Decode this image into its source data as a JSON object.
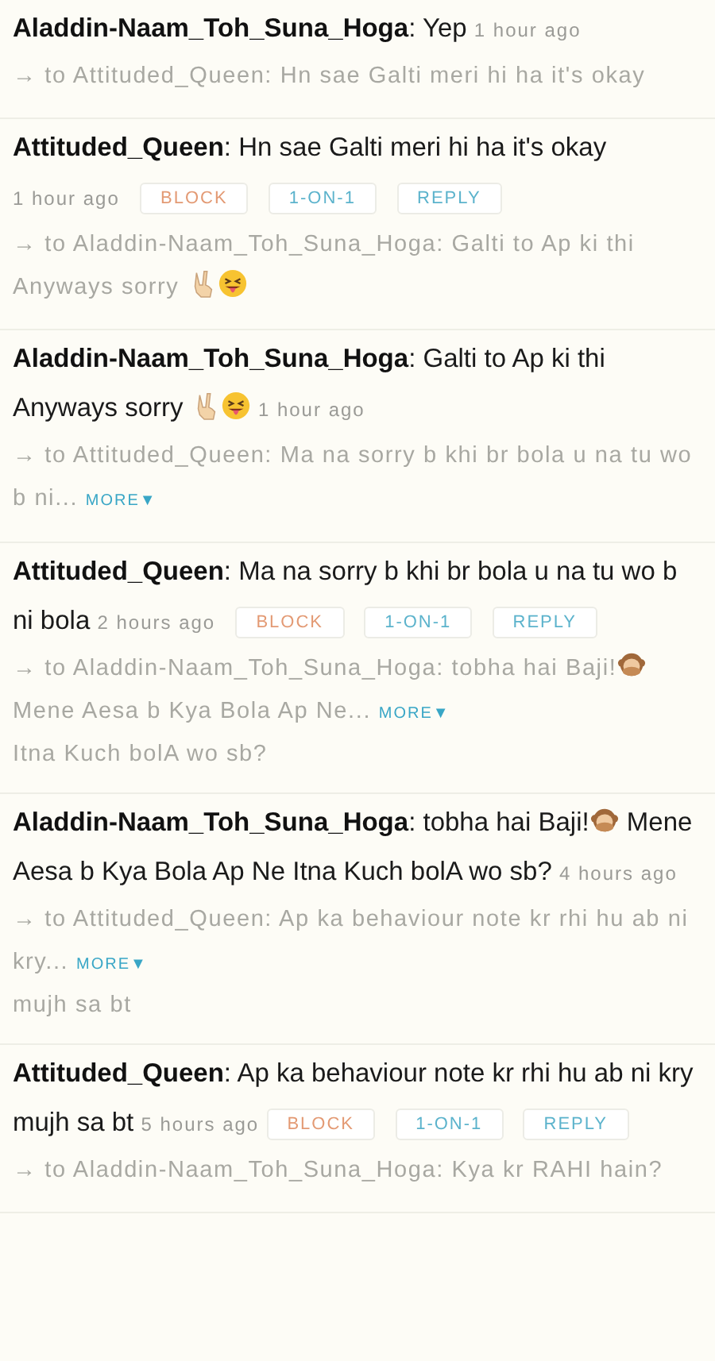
{
  "posts": [
    {
      "author": "Aladdin-Naam_Toh_Suna_Hoga",
      "separator": ":",
      "body": [
        {
          "kind": "text",
          "text": "Yep"
        }
      ],
      "time": "1 hour ago",
      "reply": {
        "body": [
          {
            "kind": "text",
            "text": "→ to Attituded_Queen: Hn sae Galti meri hi ha it's okay"
          }
        ]
      }
    },
    {
      "author": "Attituded_Queen",
      "separator": ":",
      "body": [
        {
          "kind": "text",
          "text": "Hn sae Galti meri hi ha it's okay"
        }
      ],
      "time": "1 hour ago",
      "actions": [
        {
          "label": "BLOCK",
          "color": "#e39a74"
        },
        {
          "label": "1-ON-1",
          "color": "#5cb3cc"
        },
        {
          "label": "REPLY",
          "color": "#5cb3cc"
        }
      ],
      "reply": {
        "body": [
          {
            "kind": "text",
            "text": "→ to Aladdin-Naam_Toh_Suna_Hoga: Galti to Ap ki thi Anyways sorry "
          },
          {
            "kind": "victory-hand"
          },
          {
            "kind": "tongue-face"
          }
        ]
      }
    },
    {
      "author": "Aladdin-Naam_Toh_Suna_Hoga",
      "separator": ":",
      "body": [
        {
          "kind": "text",
          "text": "Galti to Ap ki thi Anyways sorry "
        },
        {
          "kind": "victory-hand"
        },
        {
          "kind": "tongue-face"
        }
      ],
      "time": "1 hour ago",
      "reply": {
        "body": [
          {
            "kind": "text",
            "text": "→ to Attituded_Queen: Ma na sorry b khi br bola u na tu wo b ni..."
          }
        ],
        "more": "MORE▼"
      }
    },
    {
      "author": "Attituded_Queen",
      "separator": ":",
      "body": [
        {
          "kind": "text",
          "text": "Ma na sorry b khi br bola u na tu wo b ni bola"
        }
      ],
      "time": "2 hours ago",
      "actions": [
        {
          "label": "BLOCK",
          "color": "#e39a74"
        },
        {
          "label": "1-ON-1",
          "color": "#5cb3cc"
        },
        {
          "label": "REPLY",
          "color": "#5cb3cc"
        }
      ],
      "reply": {
        "body": [
          {
            "kind": "text",
            "text": "→ to Aladdin-Naam_Toh_Suna_Hoga: tobha hai Baji!"
          },
          {
            "kind": "monkey"
          },
          {
            "kind": "text",
            "text": " Mene Aesa b Kya Bola Ap Ne..."
          }
        ],
        "more": "MORE▼",
        "rest": "Itna Kuch bolA wo sb?"
      }
    },
    {
      "author": "Aladdin-Naam_Toh_Suna_Hoga",
      "separator": ":",
      "body": [
        {
          "kind": "text",
          "text": "tobha hai Baji!"
        },
        {
          "kind": "monkey"
        },
        {
          "kind": "text",
          "text": " Mene Aesa b Kya Bola Ap Ne Itna Kuch bolA wo sb?"
        }
      ],
      "time": "4 hours ago",
      "reply": {
        "body": [
          {
            "kind": "text",
            "text": "→ to Attituded_Queen: Ap ka behaviour note kr rhi hu ab ni kry..."
          }
        ],
        "more": "MORE▼",
        "rest": "mujh sa bt"
      }
    },
    {
      "author": "Attituded_Queen",
      "separator": ":",
      "body": [
        {
          "kind": "text",
          "text": "Ap ka behaviour note kr rhi hu ab ni kry mujh sa bt"
        }
      ],
      "time": "5 hours ago",
      "actions": [
        {
          "label": "BLOCK",
          "color": "#e39a74"
        },
        {
          "label": "1-ON-1",
          "color": "#5cb3cc"
        },
        {
          "label": "REPLY",
          "color": "#5cb3cc"
        }
      ],
      "reply": {
        "body": [
          {
            "kind": "text",
            "text": "→ to Aladdin-Naam_Toh_Suna_Hoga: Kya kr RAHI hain?"
          }
        ]
      }
    }
  ]
}
